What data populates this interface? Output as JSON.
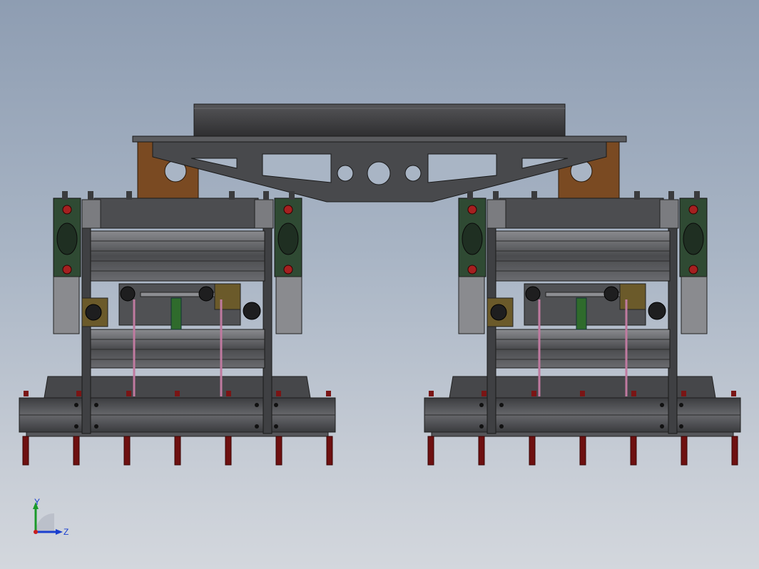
{
  "triad": {
    "axis_y_label": "Y",
    "axis_z_label": "Z",
    "colors": {
      "y": "#1a9a2a",
      "z": "#1a3fcf",
      "origin": "#c81e1e"
    }
  },
  "model": {
    "units": [
      "left",
      "right"
    ],
    "colors": {
      "plate": "#4a4a4c",
      "plate_dark": "#2f2f31",
      "bracket": "#7a4a22",
      "frame": "#595a5d",
      "rail": "#6e6f73",
      "bearing": "#2f4a33",
      "bearing_bolt": "#a52020",
      "pin": "#6e1010",
      "rod": "#c07aa0",
      "shaft": "#2f6b2c"
    }
  }
}
